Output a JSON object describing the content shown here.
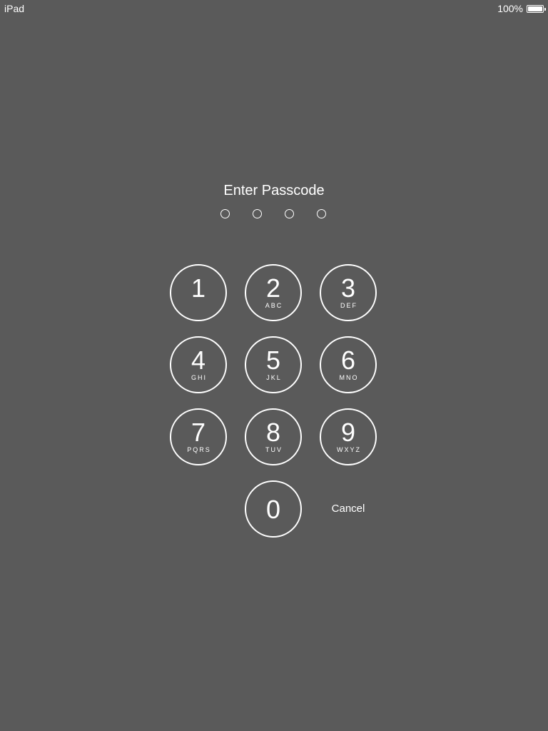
{
  "status_bar": {
    "device_name": "iPad",
    "battery_percent": "100%",
    "battery_level": 1.0
  },
  "prompt": "Enter Passcode",
  "passcode": {
    "length": 4,
    "entered": 0
  },
  "keypad": {
    "keys": [
      {
        "digit": "1",
        "letters": ""
      },
      {
        "digit": "2",
        "letters": "ABC"
      },
      {
        "digit": "3",
        "letters": "DEF"
      },
      {
        "digit": "4",
        "letters": "GHI"
      },
      {
        "digit": "5",
        "letters": "JKL"
      },
      {
        "digit": "6",
        "letters": "MNO"
      },
      {
        "digit": "7",
        "letters": "PQRS"
      },
      {
        "digit": "8",
        "letters": "TUV"
      },
      {
        "digit": "9",
        "letters": "WXYZ"
      },
      {
        "digit": "0",
        "letters": ""
      }
    ],
    "cancel_label": "Cancel"
  }
}
